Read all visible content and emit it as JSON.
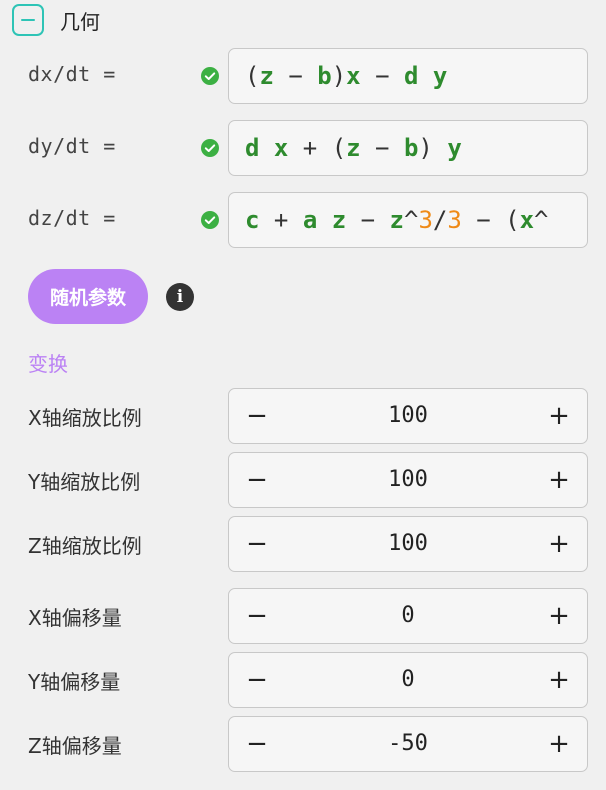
{
  "section": {
    "title": "几何"
  },
  "equations": [
    {
      "label": "dx/dt =",
      "tokens": [
        {
          "t": "(",
          "k": "op"
        },
        {
          "t": "z",
          "k": "var"
        },
        {
          "t": " − ",
          "k": "op"
        },
        {
          "t": "b",
          "k": "var"
        },
        {
          "t": ")",
          "k": "op"
        },
        {
          "t": "x",
          "k": "var"
        },
        {
          "t": " − ",
          "k": "op"
        },
        {
          "t": "d",
          "k": "var"
        },
        {
          "t": " ",
          "k": "op"
        },
        {
          "t": "y",
          "k": "var"
        }
      ]
    },
    {
      "label": "dy/dt =",
      "tokens": [
        {
          "t": "d",
          "k": "var"
        },
        {
          "t": " ",
          "k": "op"
        },
        {
          "t": "x",
          "k": "var"
        },
        {
          "t": " + (",
          "k": "op"
        },
        {
          "t": "z",
          "k": "var"
        },
        {
          "t": " − ",
          "k": "op"
        },
        {
          "t": "b",
          "k": "var"
        },
        {
          "t": ") ",
          "k": "op"
        },
        {
          "t": "y",
          "k": "var"
        }
      ]
    },
    {
      "label": "dz/dt =",
      "tokens": [
        {
          "t": "c",
          "k": "var"
        },
        {
          "t": " + ",
          "k": "op"
        },
        {
          "t": "a",
          "k": "var"
        },
        {
          "t": " ",
          "k": "op"
        },
        {
          "t": "z",
          "k": "var"
        },
        {
          "t": " − ",
          "k": "op"
        },
        {
          "t": "z",
          "k": "var"
        },
        {
          "t": "^",
          "k": "op"
        },
        {
          "t": "3",
          "k": "num"
        },
        {
          "t": "/",
          "k": "op"
        },
        {
          "t": "3",
          "k": "num"
        },
        {
          "t": " − (",
          "k": "op"
        },
        {
          "t": "x",
          "k": "var"
        },
        {
          "t": "^",
          "k": "op"
        }
      ]
    }
  ],
  "random_button": {
    "label": "随机参数"
  },
  "info_icon": {
    "glyph": "i"
  },
  "transform": {
    "title": "变换",
    "rows": [
      {
        "label": "X轴缩放比例",
        "value": "100"
      },
      {
        "label": "Y轴缩放比例",
        "value": "100"
      },
      {
        "label": "Z轴缩放比例",
        "value": "100"
      },
      {
        "label": "X轴偏移量",
        "value": "0"
      },
      {
        "label": "Y轴偏移量",
        "value": "0"
      },
      {
        "label": "Z轴偏移量",
        "value": "-50"
      }
    ],
    "minus_glyph": "−",
    "plus_glyph": "+"
  },
  "colors": {
    "accent": "#bb82f4",
    "toggle": "#2ec4b6",
    "variable": "#2e8b2e",
    "number": "#ef8a17",
    "valid": "#3cb043"
  }
}
